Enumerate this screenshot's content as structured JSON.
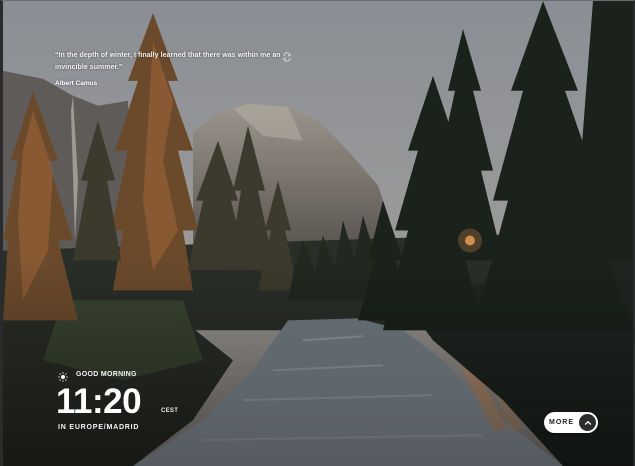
{
  "quote": {
    "text": "“In the depth of winter, I finally learned that there was within me an invincible summer.”",
    "author": "Albert Camus"
  },
  "clock": {
    "greeting": "GOOD MORNING",
    "time": "11:20",
    "tz_abbr": "CEST",
    "tz_name": "IN EUROPE/MADRID"
  },
  "more_button": {
    "label": "MORE"
  },
  "icons": {
    "refresh": "refresh-icon",
    "sun": "sun-icon",
    "arrow": "chevron-up-icon"
  },
  "colors": {
    "sky": "#8e9298",
    "forest_dark": "#1e2420",
    "river": "#8f9aa3",
    "warm_light": "#c7773b"
  }
}
